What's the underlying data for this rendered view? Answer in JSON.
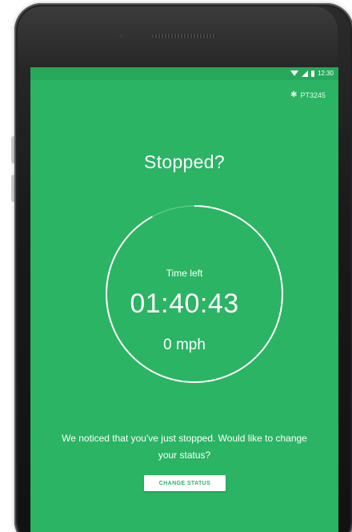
{
  "status_bar": {
    "time": "12:30"
  },
  "device": {
    "id": "PT3245",
    "icon": "bluetooth-icon"
  },
  "main": {
    "title": "Stopped?",
    "timer_label": "Time left",
    "timer_value": "01:40:43",
    "speed": "0 mph",
    "timer_progress_fraction": 0.92
  },
  "prompt": {
    "message": "We noticed that you've just stopped. Would like to change your status?",
    "button_label": "CHANGE STATUS"
  },
  "colors": {
    "accent": "#2ab463",
    "status_bar": "#27a85b",
    "text": "#ffffff"
  }
}
